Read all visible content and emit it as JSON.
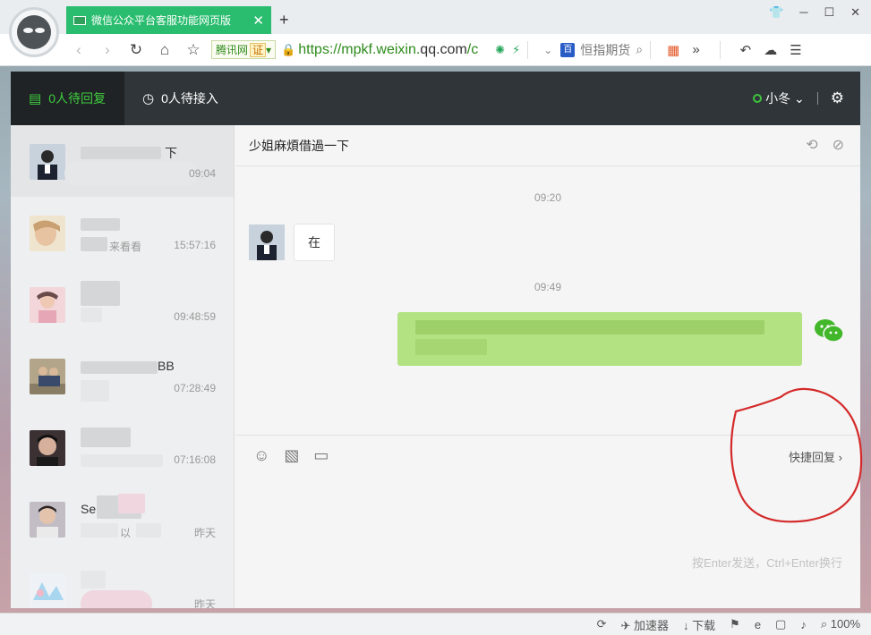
{
  "browser": {
    "tab_title": "微信公众平台客服功能网页版",
    "url_scheme": "https://mpkf.weixin.",
    "url_host": "qq.com",
    "url_rest": "/c",
    "site_badge": "腾讯网",
    "site_badge_cert": "证",
    "search_engine": "恒指期货"
  },
  "header": {
    "tab_pending_reply": "0人待回复",
    "tab_pending_accept": "0人待接入",
    "agent_name": "小冬"
  },
  "conversations": [
    {
      "name": "下",
      "time": "09:04",
      "preview": ""
    },
    {
      "name": "",
      "time": "15:57:16",
      "preview": "来看看"
    },
    {
      "name": "",
      "time": "09:48:59",
      "preview": ""
    },
    {
      "name": "BB",
      "time": "07:28:49",
      "preview": ""
    },
    {
      "name": "",
      "time": "07:16:08",
      "preview": ""
    },
    {
      "name": "Se",
      "time": "昨天",
      "preview": "以"
    },
    {
      "name": "",
      "time": "昨天",
      "preview": ""
    }
  ],
  "chat": {
    "title": "少姐麻煩借過一下",
    "time_1": "09:20",
    "received_text": "在",
    "time_2": "09:49"
  },
  "composer": {
    "quick_reply": "快捷回复",
    "hint": "按Enter发送，Ctrl+Enter换行"
  },
  "statusbar": {
    "accelerator": "加速器",
    "download": "下载",
    "zoom": "100%"
  },
  "colors": {
    "brand_green": "#3fcc3f",
    "bubble_green": "#b2e281",
    "header_dark": "#2f3539",
    "annotation_red": "#d42a2a"
  }
}
